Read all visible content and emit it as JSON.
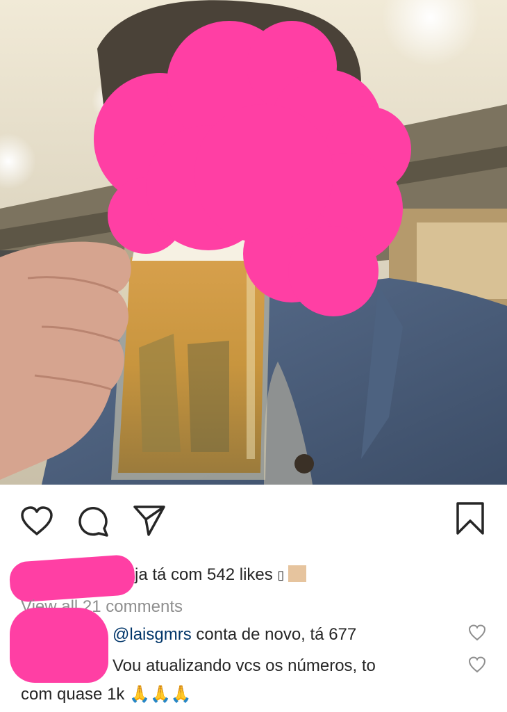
{
  "post": {
    "photo_alt": "Selfie holding a beer mug",
    "icons": {
      "like": "heart-icon",
      "comment": "comment-bubble-icon",
      "share": "paper-plane-icon",
      "save": "bookmark-icon"
    }
  },
  "caption": {
    "text": "ja tá com 542 likes",
    "emoji": "▯"
  },
  "comments_link": "View all 21 comments",
  "comments": [
    {
      "mention": "@laisgmrs",
      "text": " conta de novo, tá 677"
    },
    {
      "text_line1": "Vou atualizando vcs os números, to",
      "text_line2": "com quase 1k",
      "emoji": "🙏🙏🙏"
    }
  ],
  "colors": {
    "redaction": "#ff3fa4",
    "text": "#262626",
    "muted": "#8e8e8e",
    "link": "#003569"
  }
}
